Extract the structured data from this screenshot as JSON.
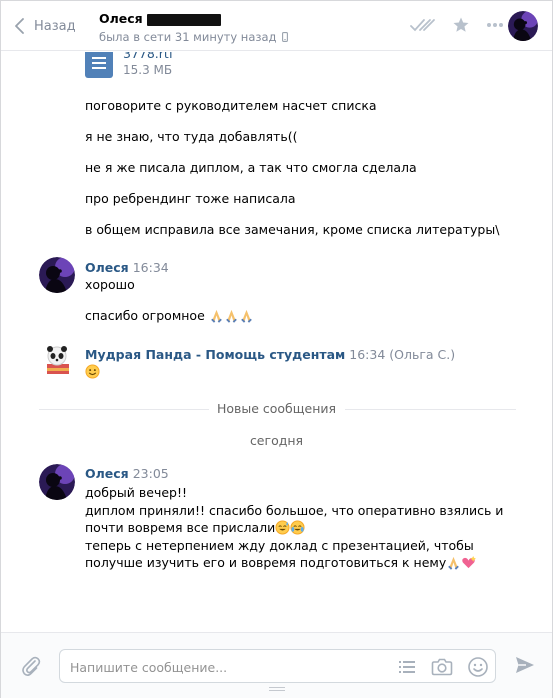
{
  "header": {
    "back_label": "Назад",
    "peer_name": "Олеся",
    "peer_status": "была в сети 31 минуту назад"
  },
  "file": {
    "name": "3778.rtf",
    "size": "15.3 МБ"
  },
  "messages_top": [
    "поговорите с руководителем насчет списка",
    "я не знаю, что туда добавлять((",
    "не я же писала диплом, а так что смогла сделала",
    "про ребрендинг тоже написала",
    "в общем исправила все замечания, кроме списка литературы\\"
  ],
  "group1": {
    "author": "Олеся",
    "time": "16:34",
    "lines": [
      "хорошо",
      "спасибо огромное"
    ]
  },
  "group2": {
    "author": "Мудрая Панда - Помощь студентам",
    "time": "16:34 (Ольга С.)"
  },
  "divider": {
    "new_messages": "Новые сообщения",
    "today": "сегодня"
  },
  "group3": {
    "author": "Олеся",
    "time": "23:05",
    "lines": [
      "добрый вечер!!",
      "диплом приняли!! спасибо большое, что оперативно взялись и",
      "почти вовремя все прислали",
      "теперь с нетерпением жду доклад с презентацией, чтобы",
      "получше изучить его и вовремя подготовиться к нему"
    ]
  },
  "composer": {
    "placeholder": "Напишите сообщение..."
  },
  "colors": {
    "link": "#2a5885",
    "muted": "#828a99",
    "accent": "#5181b8"
  }
}
